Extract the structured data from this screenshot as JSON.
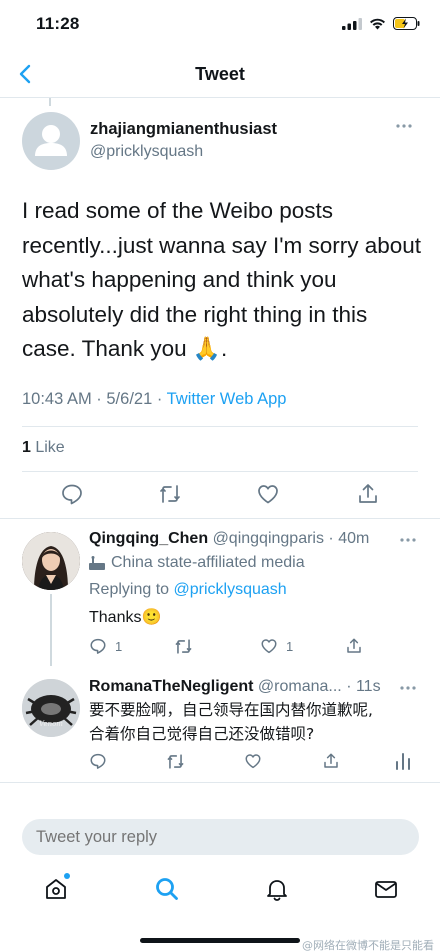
{
  "status_bar": {
    "time": "11:28"
  },
  "header": {
    "title": "Tweet"
  },
  "main_tweet": {
    "author_name": "zhajiangmianenthusiast",
    "author_handle": "@pricklysquash",
    "text": "I read some of the Weibo posts recently...just wanna say I'm sorry about what's happening and think you absolutely did the right thing in this case. Thank you 🙏.",
    "timestamp": "10:43 AM · 5/6/21 · ",
    "source": "Twitter Web App",
    "like_count": "1",
    "like_label": " Like"
  },
  "replies": [
    {
      "name": "Qingqing_Chen",
      "handle": "@qingqingparis · 40m",
      "label": "China state-affiliated media",
      "replying_prefix": "Replying to ",
      "replying_to": "@pricklysquash",
      "text": "Thanks🙂",
      "reply_count": "1",
      "like_count": "1"
    },
    {
      "name": "RomanaTheNegligent",
      "handle": "@romana... · 11s",
      "text_line1": "要不要脸啊，自己领导在国内替你道歉呢,",
      "text_line2": "合着你自己觉得自己还没做错呗?"
    }
  ],
  "compose": {
    "placeholder": "Tweet your reply"
  },
  "watermark": "@网络在微博不能是只能看",
  "colors": {
    "accent": "#1da1f2",
    "muted": "#657786"
  }
}
